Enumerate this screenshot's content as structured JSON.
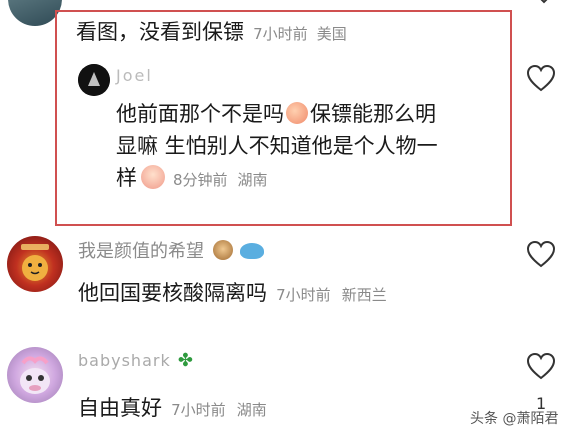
{
  "comments": [
    {
      "text": "看图，没看到保镖",
      "time": "7小时前",
      "location": "美国",
      "reply": {
        "username": "Joel",
        "text_line1": "他前面那个不是吗",
        "text_line1b": "保镖能那么明",
        "text_line2": "显嘛 生怕别人不知道他是个人物一",
        "text_line3": "样",
        "time": "8分钟前",
        "location": "湖南"
      }
    },
    {
      "username": "我是颜值的希望",
      "text": "他回国要核酸隔离吗",
      "time": "7小时前",
      "location": "新西兰"
    },
    {
      "username": "babyshark",
      "text": "自由真好",
      "time": "7小时前",
      "location": "湖南",
      "like_count": "1"
    }
  ],
  "watermark": "头条 @萧陌君",
  "colors": {
    "highlight_border": "#d05050",
    "meta_text": "#8a8a8a"
  }
}
